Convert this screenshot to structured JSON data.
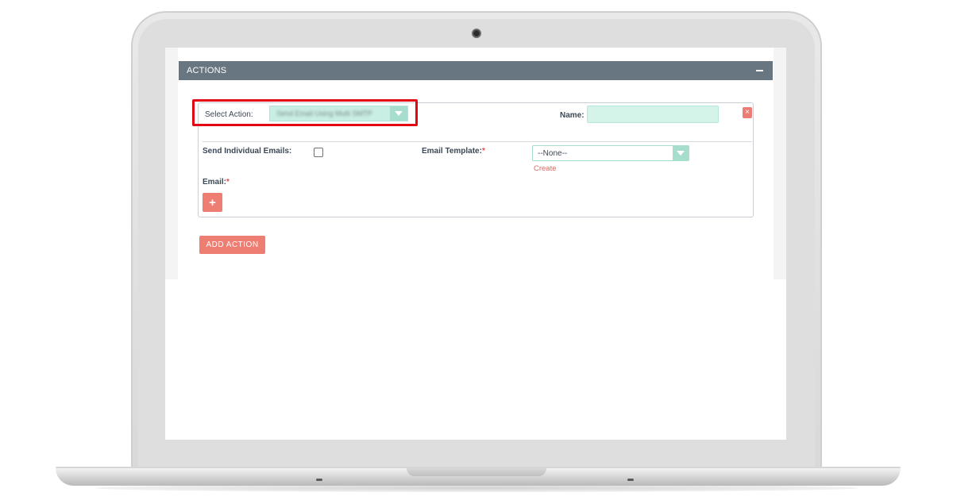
{
  "panel": {
    "title": "ACTIONS"
  },
  "action": {
    "select_action_label": "Select Action:",
    "select_action_value": "Send Email Using Multi SMTP",
    "name_label": "Name:",
    "name_value": "",
    "send_individual_label": "Send Individual Emails:",
    "send_individual_checked": false,
    "email_template_label": "Email Template:",
    "email_template_value": "--None--",
    "create_link": "Create",
    "email_label": "Email:",
    "required_mark": "*",
    "add_email_symbol": "+",
    "remove_symbol": "×"
  },
  "add_action_label": "ADD ACTION",
  "colors": {
    "header_bg": "#687682",
    "accent_teal": "#a6ddcd",
    "button_coral": "#ee7d72",
    "highlight_red": "#e30613"
  },
  "icons": {
    "collapse": "minus-icon",
    "remove": "close-icon",
    "dropdown": "chevron-down-icon",
    "add": "plus-icon"
  }
}
